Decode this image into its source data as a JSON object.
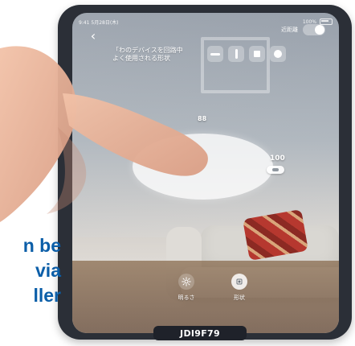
{
  "status_bar": {
    "left": "9:41 5月28日(木)",
    "right": "100%"
  },
  "top_bar": {
    "toggle_label": "近距離",
    "toggle_state": "on"
  },
  "instruction_text": "「わのデバイスを回路中\nよく使用される形状",
  "shape_buttons": [
    {
      "name": "horizontal-line",
      "icon": "horizontal-line-icon"
    },
    {
      "name": "vertical-line",
      "icon": "vertical-line-icon"
    },
    {
      "name": "square",
      "icon": "square-icon"
    },
    {
      "name": "circle",
      "icon": "circle-icon"
    }
  ],
  "control": {
    "top_value": "88",
    "right_value": "100"
  },
  "bottom_controls": [
    {
      "label": "明るさ",
      "icon": "brightness-icon",
      "selected": false
    },
    {
      "label": "形状",
      "icon": "shape-icon",
      "selected": true
    }
  ],
  "device_id": "JDI9F79",
  "caption_lines": [
    "n be",
    "via",
    "ller"
  ],
  "colors": {
    "caption": "#0b5ea8",
    "frame": "#2b2f37"
  }
}
